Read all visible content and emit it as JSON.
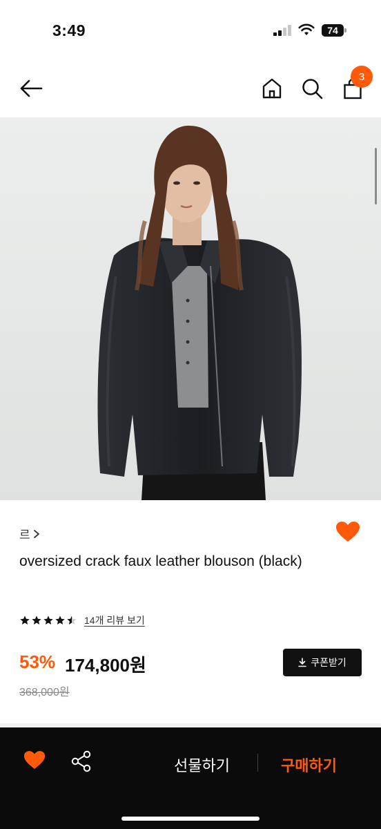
{
  "status_bar": {
    "time": "3:49",
    "battery": "74"
  },
  "nav": {
    "cart_count": "3"
  },
  "product": {
    "brand": "르",
    "title": "oversized crack faux leather blouson (black)",
    "rating": 4.5,
    "review_link": "14개 리뷰 보기",
    "discount": "53%",
    "price": "174,800원",
    "original_price": "368,000원",
    "coupon_label": "쿠폰받기"
  },
  "bottom_bar": {
    "gift_label": "선물하기",
    "buy_label": "구매하기"
  },
  "colors": {
    "accent": "#ff5a0a",
    "dark": "#111111"
  }
}
